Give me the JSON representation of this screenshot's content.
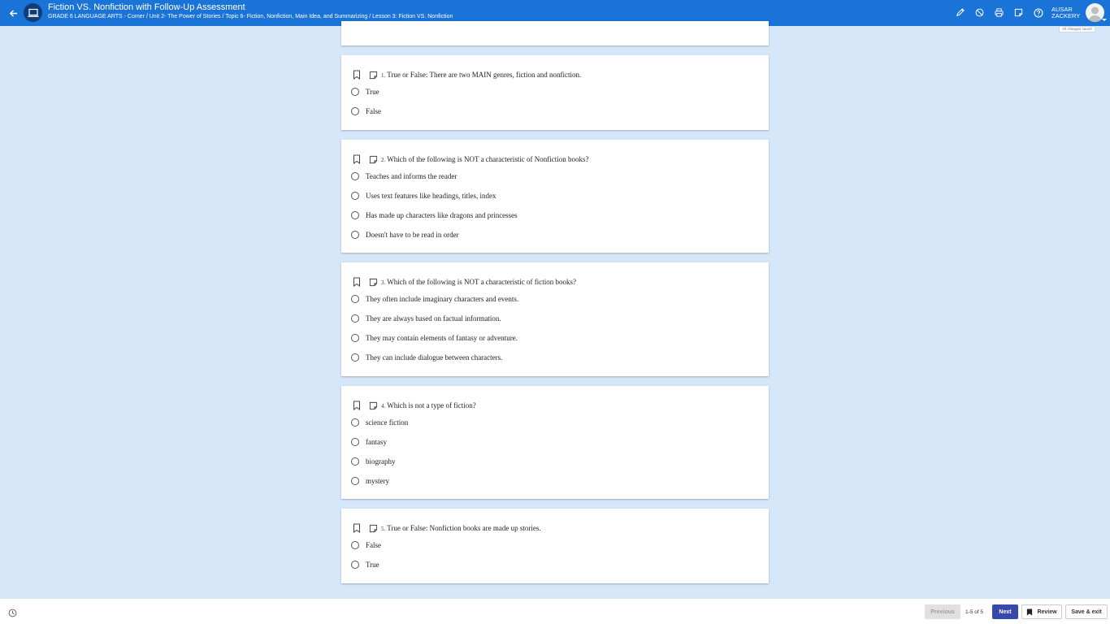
{
  "header": {
    "title": "Fiction VS. Nonfiction with Follow-Up Assessment",
    "breadcrumb": "GRADE 6 LANGUAGE ARTS - Comer / Unit 2- The Power of Stories / Topic 6- Fiction, Nonfiction, Main Idea, and Summarizing / Lesson 3: Fiction VS. Nonfiction",
    "user_first": "AUSAR",
    "user_last": "ZACKERY",
    "save_status": "All changes saved",
    "icons": [
      "arrow-back-icon",
      "laptop-icon",
      "pencil-icon",
      "block-icon",
      "print-icon",
      "note-icon",
      "help-icon"
    ]
  },
  "questions": [
    {
      "number": "1.",
      "text": "True or False: There are two MAIN genres, fiction and nonfiction.",
      "choices": [
        "True",
        "False"
      ]
    },
    {
      "number": "2.",
      "text": "Which of the following is NOT a characteristic of Nonfiction books?",
      "choices": [
        "Teaches and informs the reader",
        "Uses text features like headings, titles, index",
        "Has made up characters like dragons and princesses",
        "Doesn't have to be read in order"
      ]
    },
    {
      "number": "3.",
      "text": "Which of the following is NOT a characteristic of fiction books?",
      "choices": [
        "They often include imaginary characters and events.",
        "They are always based on factual information.",
        "They may contain elements of fantasy or adventure.",
        "They can include dialogue between characters."
      ]
    },
    {
      "number": "4.",
      "text": "Which is not a type of fiction?",
      "choices": [
        "science fiction",
        "fantasy",
        "biography",
        "mystery"
      ]
    },
    {
      "number": "5.",
      "text": "True or False: Nonfiction books are made up stories.",
      "choices": [
        "False",
        "True"
      ]
    }
  ],
  "footer": {
    "previous_label": "Previous",
    "page_count": "1-5 of 5",
    "next_label": "Next",
    "review_label": "Review",
    "save_exit_label": "Save & exit"
  },
  "colors": {
    "header": "#1a73d6",
    "background": "#d6e7fa",
    "next_button": "#3949ab"
  }
}
